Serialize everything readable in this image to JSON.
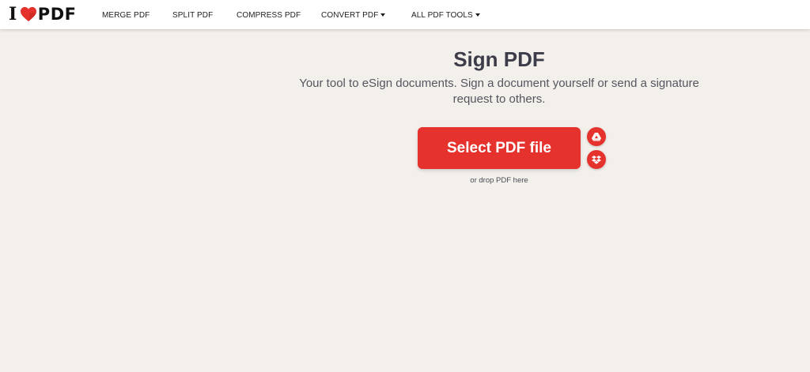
{
  "brand": {
    "logo_left": "I",
    "logo_right": "PDF",
    "accent_color": "#e5322d"
  },
  "nav": {
    "items": [
      {
        "label": "MERGE PDF",
        "dropdown": false
      },
      {
        "label": "SPLIT PDF",
        "dropdown": false
      },
      {
        "label": "COMPRESS PDF",
        "dropdown": false
      },
      {
        "label": "CONVERT PDF",
        "dropdown": true
      },
      {
        "label": "ALL PDF TOOLS",
        "dropdown": true
      }
    ]
  },
  "hero": {
    "title": "Sign PDF",
    "subtitle": "Your tool to eSign documents. Sign a document yourself or send a signature request to others.",
    "select_button_label": "Select PDF file",
    "drop_hint": "or drop PDF here",
    "cloud_buttons": [
      {
        "icon": "google-drive-icon"
      },
      {
        "icon": "dropbox-icon"
      }
    ]
  }
}
